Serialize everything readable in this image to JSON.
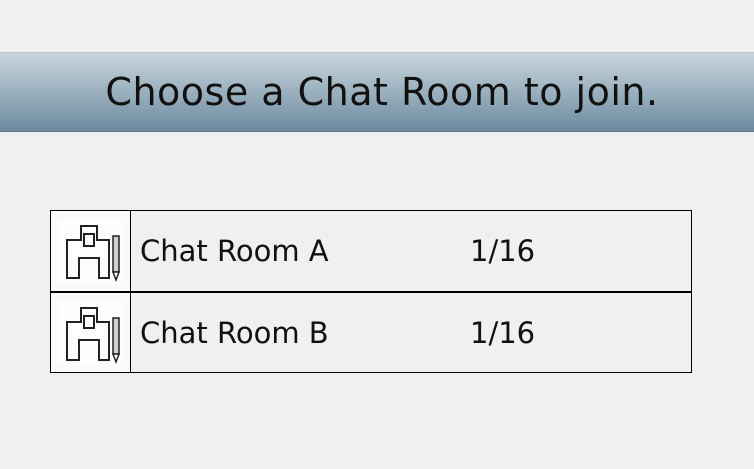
{
  "header": {
    "title": "Choose a Chat Room to join."
  },
  "rooms": [
    {
      "name": "Chat Room A",
      "occupancy": "1/16",
      "icon": "chat-room-icon"
    },
    {
      "name": "Chat Room B",
      "occupancy": "1/16",
      "icon": "chat-room-icon"
    }
  ]
}
